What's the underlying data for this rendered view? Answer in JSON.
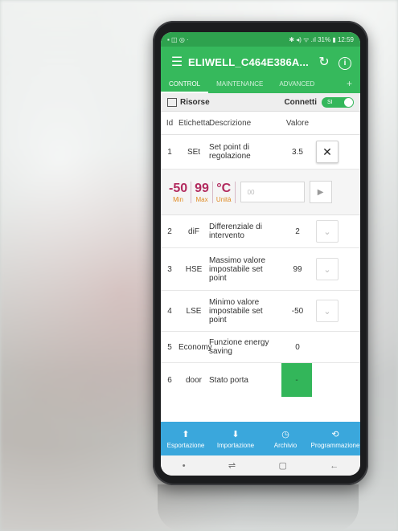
{
  "status_bar": {
    "left": "▪ ◫ ◎ ·",
    "right": "✱ ◂) ᯤ .ıl 31% ▮ 12:59"
  },
  "appbar": {
    "menu_icon": "☰",
    "title": "ELIWELL_C464E386A...",
    "refresh_icon": "↻",
    "info_icon": "i"
  },
  "tabs": [
    {
      "label": "CONTROL",
      "active": true
    },
    {
      "label": "MAINTENANCE",
      "active": false
    },
    {
      "label": "ADVANCED",
      "active": false
    },
    {
      "label": "+",
      "active": false
    }
  ],
  "toolbar": {
    "resources_label": "Risorse",
    "connect_label": "Connetti",
    "toggle_label": "SI"
  },
  "columns": {
    "id": "Id",
    "label": "Etichetta",
    "description": "Descrizione",
    "value": "Valore"
  },
  "rows": [
    {
      "id": "1",
      "label": "SEt",
      "description": "Set point di regolazione",
      "value": "3.5",
      "btn": "✕"
    },
    {
      "id": "2",
      "label": "diF",
      "description": "Differenziale di intervento",
      "value": "2",
      "btn": "⌄"
    },
    {
      "id": "3",
      "label": "HSE",
      "description": "Massimo valore impostabile set point",
      "value": "99",
      "btn": "⌄"
    },
    {
      "id": "4",
      "label": "LSE",
      "description": "Minimo valore impostabile set point",
      "value": "-50",
      "btn": "⌄"
    },
    {
      "id": "5",
      "label": "Economy",
      "description": "Funzione energy saving",
      "value": "0"
    },
    {
      "id": "6",
      "label": "door",
      "description": "Stato porta",
      "value": "-"
    }
  ],
  "editor": {
    "min_value": "-50",
    "min_label": "Min",
    "max_value": "99",
    "max_label": "Max",
    "unit_value": "°C",
    "unit_label": "Unità",
    "input_placeholder": "00",
    "send_icon": "▶"
  },
  "bottom_nav": [
    {
      "icon": "⬆",
      "label": "Esportazione"
    },
    {
      "icon": "⬇",
      "label": "Importazione"
    },
    {
      "icon": "◷",
      "label": "Archivio"
    },
    {
      "icon": "⟲",
      "label": "Programmazione"
    }
  ],
  "system_nav": {
    "dot": "•",
    "recent": "⇌",
    "home": "▢",
    "back": "←"
  },
  "colors": {
    "primary": "#36b95c",
    "status": "#2ea24e",
    "accent_blue": "#3aa7dc",
    "limit_red": "#b22a5e",
    "limit_orange": "#e08a22"
  }
}
